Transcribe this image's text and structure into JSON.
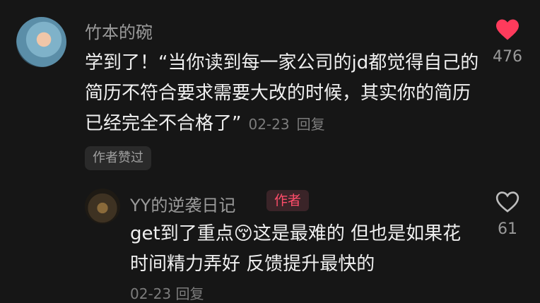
{
  "comment": {
    "username": "竹本的碗",
    "text": "学到了！“当你读到每一家公司的jd都觉得自己的简历不符合要求需要大改的时候，其实你的简历已经完全不合格了”",
    "date": "02-23",
    "reply_label": "回复",
    "author_liked_badge": "作者赞过",
    "like_count": "476",
    "liked": true
  },
  "reply": {
    "username": "YY的逆袭日记",
    "author_tag": "作者",
    "text_before_emoji": "get到了重点",
    "emoji": "😚",
    "text_after_emoji": "这是最难的 但也是如果花时间精力弄好 反馈提升最快的",
    "date": "02-23",
    "reply_label": "回复",
    "like_count": "61",
    "liked": false
  },
  "colors": {
    "background": "#161616",
    "like_red": "#ff3b5c",
    "author_tag_text": "#ff4d6a"
  },
  "icons": {
    "liked": "heart-filled-icon",
    "unliked": "heart-outline-icon"
  }
}
